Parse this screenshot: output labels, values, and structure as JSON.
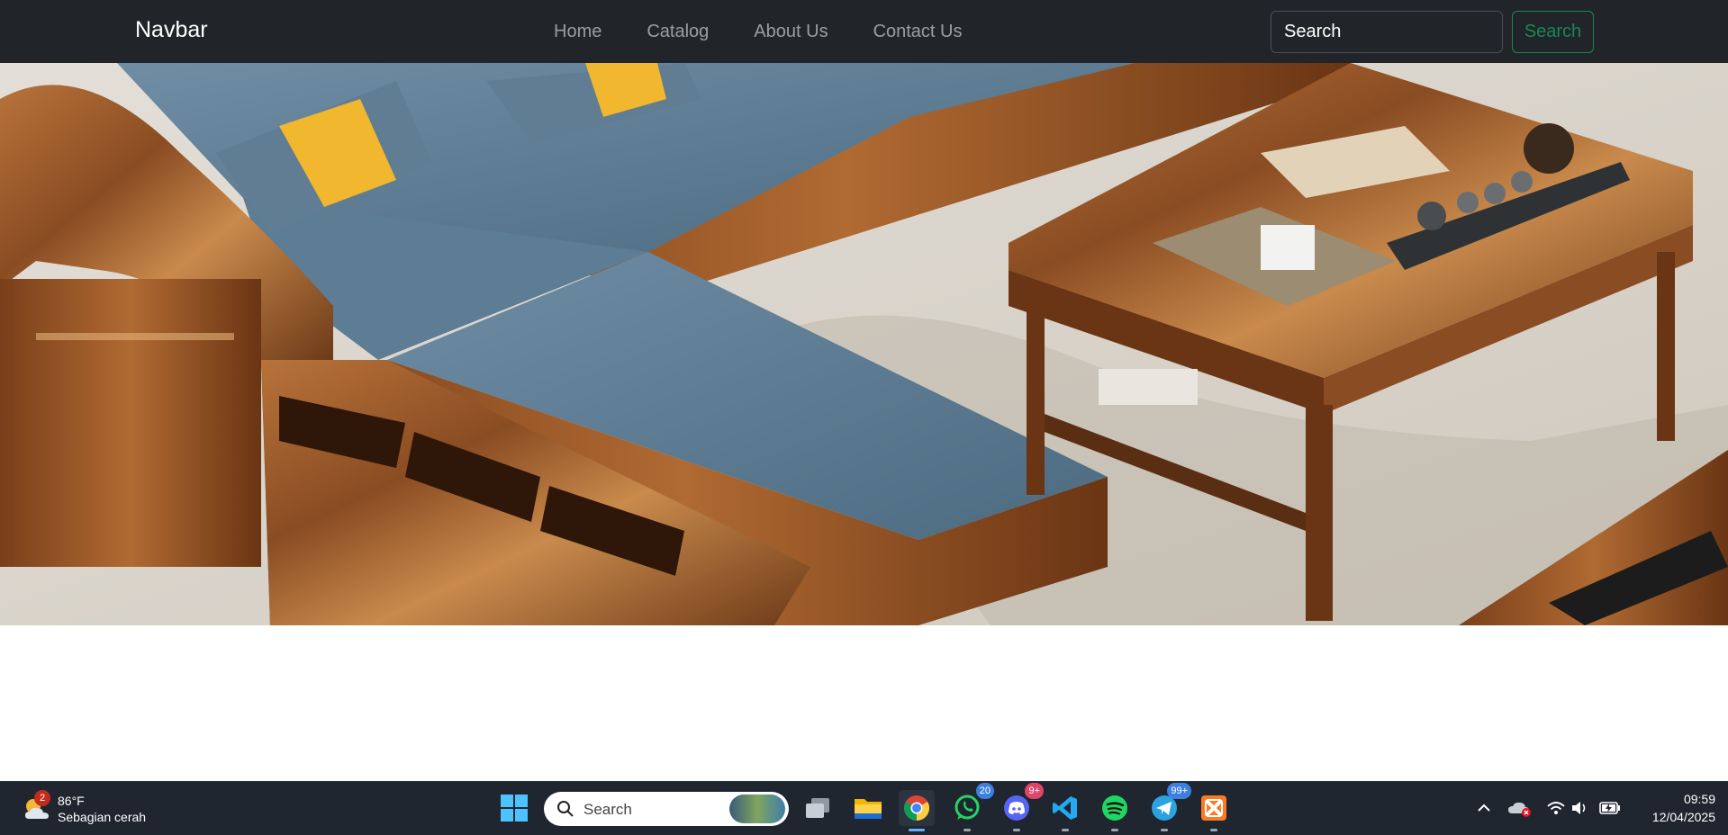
{
  "navbar": {
    "brand": "Navbar",
    "links": [
      "Home",
      "Catalog",
      "About Us",
      "Contact Us"
    ],
    "search_placeholder": "Search",
    "search_button": "Search",
    "button_color": "#198754",
    "background": "#212529"
  },
  "hero": {
    "image": "living-room-sofa-and-coffee-table"
  },
  "taskbar": {
    "weather": {
      "badge": "2",
      "temp": "86°F",
      "desc": "Sebagian cerah",
      "icon": "partly-cloudy-icon"
    },
    "search_label": "Search",
    "apps": [
      {
        "name": "windows-start-icon"
      },
      {
        "name": "task-view-icon"
      },
      {
        "name": "file-explorer-icon"
      },
      {
        "name": "chrome-icon",
        "active": true
      },
      {
        "name": "whatsapp-icon",
        "badge": "20"
      },
      {
        "name": "discord-icon",
        "badge": "9+"
      },
      {
        "name": "vscode-icon"
      },
      {
        "name": "spotify-icon"
      },
      {
        "name": "telegram-icon",
        "badge": "99+"
      },
      {
        "name": "xampp-icon"
      }
    ],
    "tray": {
      "time": "09:59",
      "date": "12/04/2025"
    }
  }
}
